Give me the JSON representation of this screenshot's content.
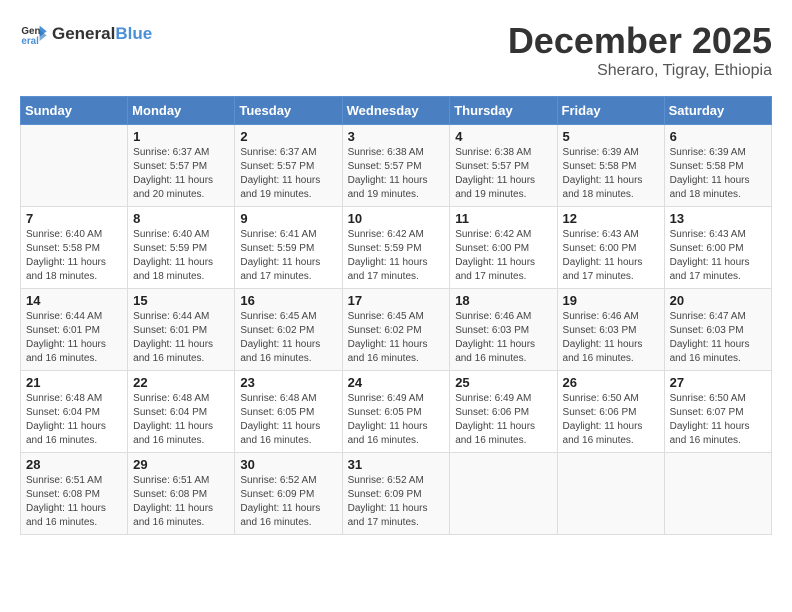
{
  "header": {
    "logo_general": "General",
    "logo_blue": "Blue",
    "month": "December 2025",
    "location": "Sheraro, Tigray, Ethiopia"
  },
  "days_of_week": [
    "Sunday",
    "Monday",
    "Tuesday",
    "Wednesday",
    "Thursday",
    "Friday",
    "Saturday"
  ],
  "weeks": [
    [
      {
        "day": "",
        "content": ""
      },
      {
        "day": "1",
        "content": "Sunrise: 6:37 AM\nSunset: 5:57 PM\nDaylight: 11 hours\nand 20 minutes."
      },
      {
        "day": "2",
        "content": "Sunrise: 6:37 AM\nSunset: 5:57 PM\nDaylight: 11 hours\nand 19 minutes."
      },
      {
        "day": "3",
        "content": "Sunrise: 6:38 AM\nSunset: 5:57 PM\nDaylight: 11 hours\nand 19 minutes."
      },
      {
        "day": "4",
        "content": "Sunrise: 6:38 AM\nSunset: 5:57 PM\nDaylight: 11 hours\nand 19 minutes."
      },
      {
        "day": "5",
        "content": "Sunrise: 6:39 AM\nSunset: 5:58 PM\nDaylight: 11 hours\nand 18 minutes."
      },
      {
        "day": "6",
        "content": "Sunrise: 6:39 AM\nSunset: 5:58 PM\nDaylight: 11 hours\nand 18 minutes."
      }
    ],
    [
      {
        "day": "7",
        "content": "Sunrise: 6:40 AM\nSunset: 5:58 PM\nDaylight: 11 hours\nand 18 minutes."
      },
      {
        "day": "8",
        "content": "Sunrise: 6:40 AM\nSunset: 5:59 PM\nDaylight: 11 hours\nand 18 minutes."
      },
      {
        "day": "9",
        "content": "Sunrise: 6:41 AM\nSunset: 5:59 PM\nDaylight: 11 hours\nand 17 minutes."
      },
      {
        "day": "10",
        "content": "Sunrise: 6:42 AM\nSunset: 5:59 PM\nDaylight: 11 hours\nand 17 minutes."
      },
      {
        "day": "11",
        "content": "Sunrise: 6:42 AM\nSunset: 6:00 PM\nDaylight: 11 hours\nand 17 minutes."
      },
      {
        "day": "12",
        "content": "Sunrise: 6:43 AM\nSunset: 6:00 PM\nDaylight: 11 hours\nand 17 minutes."
      },
      {
        "day": "13",
        "content": "Sunrise: 6:43 AM\nSunset: 6:00 PM\nDaylight: 11 hours\nand 17 minutes."
      }
    ],
    [
      {
        "day": "14",
        "content": "Sunrise: 6:44 AM\nSunset: 6:01 PM\nDaylight: 11 hours\nand 16 minutes."
      },
      {
        "day": "15",
        "content": "Sunrise: 6:44 AM\nSunset: 6:01 PM\nDaylight: 11 hours\nand 16 minutes."
      },
      {
        "day": "16",
        "content": "Sunrise: 6:45 AM\nSunset: 6:02 PM\nDaylight: 11 hours\nand 16 minutes."
      },
      {
        "day": "17",
        "content": "Sunrise: 6:45 AM\nSunset: 6:02 PM\nDaylight: 11 hours\nand 16 minutes."
      },
      {
        "day": "18",
        "content": "Sunrise: 6:46 AM\nSunset: 6:03 PM\nDaylight: 11 hours\nand 16 minutes."
      },
      {
        "day": "19",
        "content": "Sunrise: 6:46 AM\nSunset: 6:03 PM\nDaylight: 11 hours\nand 16 minutes."
      },
      {
        "day": "20",
        "content": "Sunrise: 6:47 AM\nSunset: 6:03 PM\nDaylight: 11 hours\nand 16 minutes."
      }
    ],
    [
      {
        "day": "21",
        "content": "Sunrise: 6:48 AM\nSunset: 6:04 PM\nDaylight: 11 hours\nand 16 minutes."
      },
      {
        "day": "22",
        "content": "Sunrise: 6:48 AM\nSunset: 6:04 PM\nDaylight: 11 hours\nand 16 minutes."
      },
      {
        "day": "23",
        "content": "Sunrise: 6:48 AM\nSunset: 6:05 PM\nDaylight: 11 hours\nand 16 minutes."
      },
      {
        "day": "24",
        "content": "Sunrise: 6:49 AM\nSunset: 6:05 PM\nDaylight: 11 hours\nand 16 minutes."
      },
      {
        "day": "25",
        "content": "Sunrise: 6:49 AM\nSunset: 6:06 PM\nDaylight: 11 hours\nand 16 minutes."
      },
      {
        "day": "26",
        "content": "Sunrise: 6:50 AM\nSunset: 6:06 PM\nDaylight: 11 hours\nand 16 minutes."
      },
      {
        "day": "27",
        "content": "Sunrise: 6:50 AM\nSunset: 6:07 PM\nDaylight: 11 hours\nand 16 minutes."
      }
    ],
    [
      {
        "day": "28",
        "content": "Sunrise: 6:51 AM\nSunset: 6:08 PM\nDaylight: 11 hours\nand 16 minutes."
      },
      {
        "day": "29",
        "content": "Sunrise: 6:51 AM\nSunset: 6:08 PM\nDaylight: 11 hours\nand 16 minutes."
      },
      {
        "day": "30",
        "content": "Sunrise: 6:52 AM\nSunset: 6:09 PM\nDaylight: 11 hours\nand 16 minutes."
      },
      {
        "day": "31",
        "content": "Sunrise: 6:52 AM\nSunset: 6:09 PM\nDaylight: 11 hours\nand 17 minutes."
      },
      {
        "day": "",
        "content": ""
      },
      {
        "day": "",
        "content": ""
      },
      {
        "day": "",
        "content": ""
      }
    ]
  ]
}
